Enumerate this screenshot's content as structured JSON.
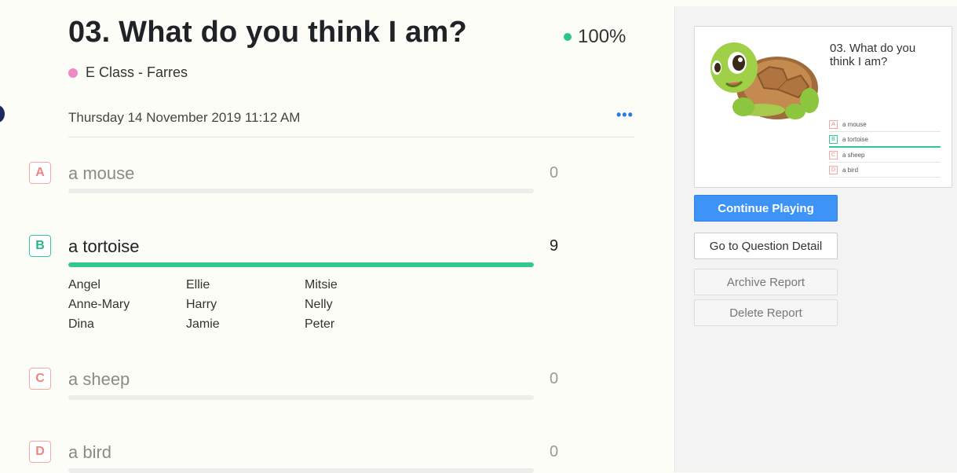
{
  "header": {
    "title": "03. What do you think I am?",
    "score": "100%",
    "class_name": "E Class - Farres",
    "date": "Thursday 14 November 2019 11:12 AM",
    "more_label": "•••"
  },
  "options": [
    {
      "letter": "A",
      "text": "a mouse",
      "count": "0",
      "correct": false,
      "fill": 0
    },
    {
      "letter": "B",
      "text": "a tortoise",
      "count": "9",
      "correct": true,
      "fill": 1,
      "names": [
        "Angel",
        "Ellie",
        "Mitsie",
        "Anne-Mary",
        "Harry",
        "Nelly",
        "Dina",
        "Jamie",
        "Peter"
      ]
    },
    {
      "letter": "C",
      "text": "a sheep",
      "count": "0",
      "correct": false,
      "fill": 0
    },
    {
      "letter": "D",
      "text": "a bird",
      "count": "0",
      "correct": false,
      "fill": 0
    }
  ],
  "preview": {
    "title": "03. What do you think I am?",
    "options": [
      {
        "letter": "A",
        "text": "a mouse"
      },
      {
        "letter": "B",
        "text": "a tortoise"
      },
      {
        "letter": "C",
        "text": "a sheep"
      },
      {
        "letter": "D",
        "text": "a bird"
      }
    ]
  },
  "buttons": {
    "continue": "Continue Playing",
    "detail": "Go to Question Detail",
    "archive": "Archive Report",
    "delete": "Delete Report"
  },
  "colors": {
    "correct": "#33c88f",
    "wrong_letter": "#f08580",
    "primary": "#3d94f6",
    "class_dot": "#f08ac4"
  }
}
